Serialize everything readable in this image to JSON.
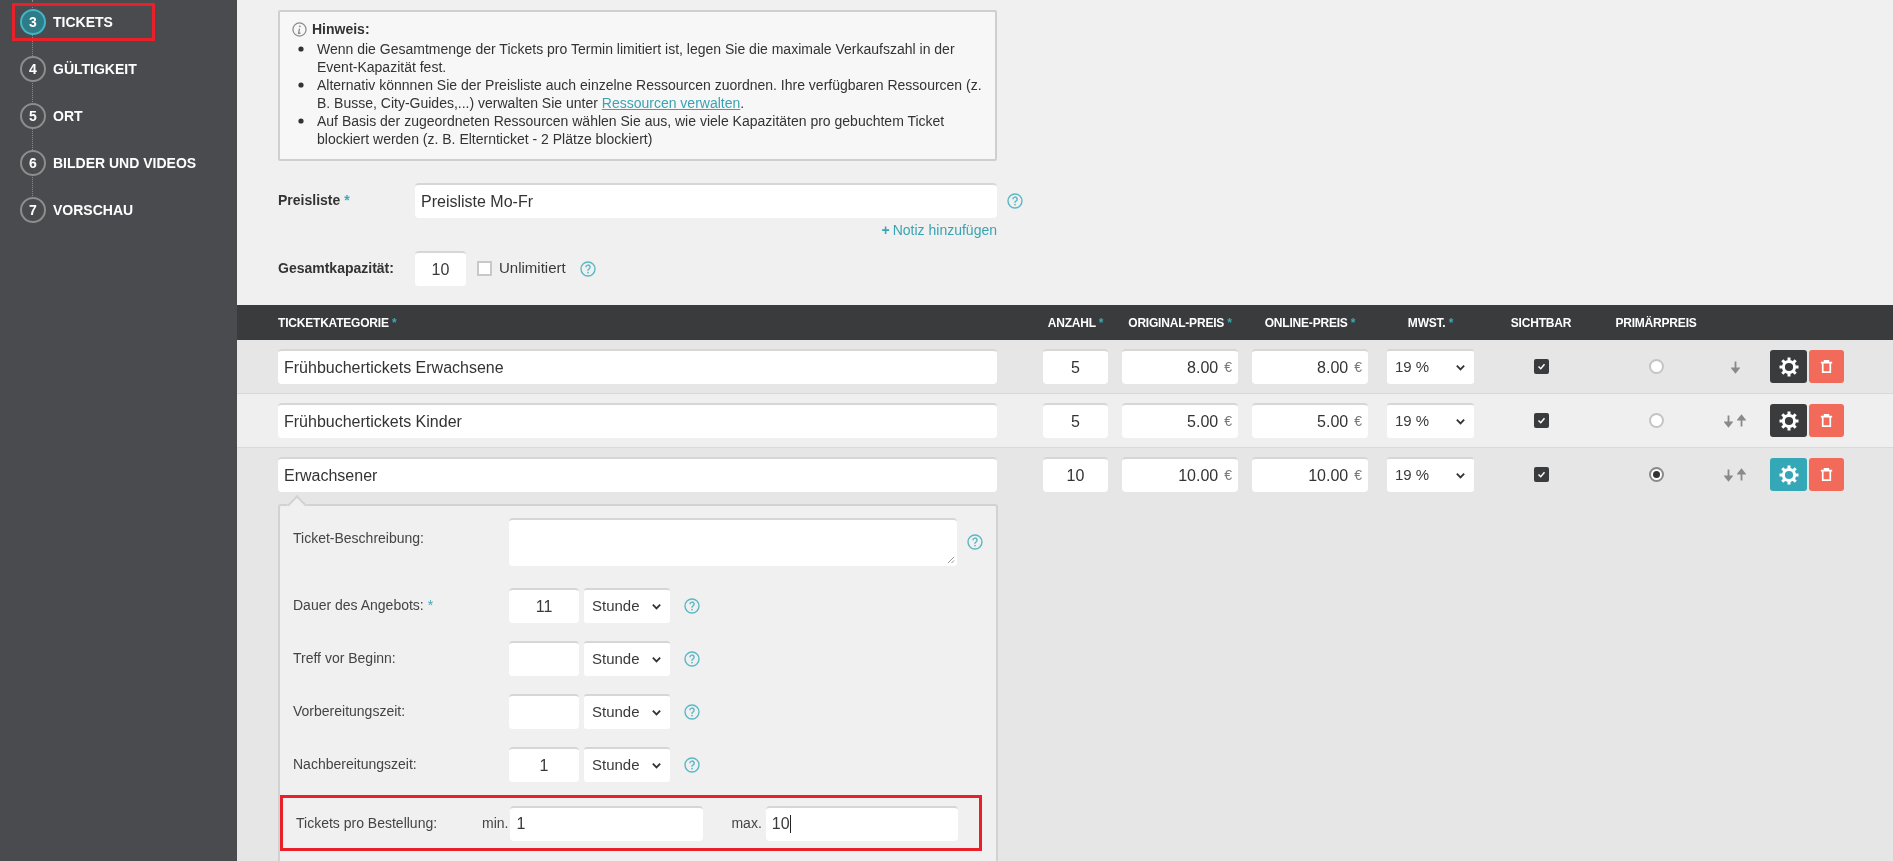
{
  "sidebar": {
    "steps": [
      {
        "number": "3",
        "label": "TICKETS",
        "selected": true,
        "highlighted": true
      },
      {
        "number": "4",
        "label": "GÜLTIGKEIT",
        "selected": false,
        "highlighted": false
      },
      {
        "number": "5",
        "label": "ORT",
        "selected": false,
        "highlighted": false
      },
      {
        "number": "6",
        "label": "BILDER UND VIDEOS",
        "selected": false,
        "highlighted": false
      },
      {
        "number": "7",
        "label": "VORSCHAU",
        "selected": false,
        "highlighted": false
      }
    ]
  },
  "hint": {
    "title": "Hinweis:",
    "items": [
      {
        "text": "Wenn die Gesamtmenge der Tickets pro Termin limitiert ist, legen Sie die maximale Verkaufszahl in der Event-Kapazität fest."
      },
      {
        "text": "Alternativ könnnen Sie der Preisliste auch einzelne Ressourcen zuordnen. Ihre verfügbaren Ressourcen (z. B. Busse, City-Guides,...) verwalten Sie unter ",
        "link": "Ressourcen verwalten",
        "tail": "."
      },
      {
        "text": "Auf Basis der zugeordneten Ressourcen wählen Sie aus, wie viele Kapazitäten pro gebuchtem Ticket blockiert werden (z. B. Elternticket - 2 Plätze blockiert)"
      }
    ]
  },
  "price_list": {
    "label": "Preisliste",
    "mark": "*",
    "value": "Preisliste Mo-Fr",
    "note_plus": "+",
    "note_link": "Notiz hinzufügen"
  },
  "capacity": {
    "label": "Gesamtkapazität:",
    "value": "10",
    "unlimited_label": "Unlimitiert",
    "unlimited": false
  },
  "table": {
    "columns": [
      {
        "label": "TICKETKATEGORIE",
        "mark": "*"
      },
      {
        "label": "ANZAHL",
        "mark": "*"
      },
      {
        "label": "ORIGINAL-PREIS",
        "mark": "*"
      },
      {
        "label": "ONLINE-PREIS",
        "mark": "*"
      },
      {
        "label": "MWST.",
        "mark": "*"
      },
      {
        "label": "SICHTBAR"
      },
      {
        "label": "PRIMÄRPREIS"
      }
    ],
    "rows": [
      {
        "name": "Frühbuchertickets Erwachsene",
        "count": "5",
        "original_price": "8.00",
        "original_currency": "€",
        "online_price": "8.00",
        "online_currency": "€",
        "vat": "19 %",
        "visible": true,
        "selected": false,
        "move_down": true,
        "move_up": false,
        "expanded": false
      },
      {
        "name": "Frühbuchertickets Kinder",
        "count": "5",
        "original_price": "5.00",
        "original_currency": "€",
        "online_price": "5.00",
        "online_currency": "€",
        "vat": "19 %",
        "visible": true,
        "selected": false,
        "move_down": true,
        "move_up": true,
        "expanded": false
      },
      {
        "name": "Erwachsener",
        "count": "10",
        "original_price": "10.00",
        "original_currency": "€",
        "online_price": "10.00",
        "online_currency": "€",
        "vat": "19 %",
        "visible": true,
        "selected": true,
        "move_down": true,
        "move_up": true,
        "expanded": true
      }
    ]
  },
  "details": {
    "fields": [
      {
        "kind": "textarea",
        "label": "Ticket-Beschreibung:"
      },
      {
        "kind": "duration",
        "label": "Dauer des Angebots:",
        "mark": "*",
        "value": "11",
        "unit": "Stunde"
      },
      {
        "kind": "duration",
        "label": "Treff vor Beginn:",
        "unit": "Stunde"
      },
      {
        "kind": "duration",
        "label": "Vorbereitungszeit:",
        "unit": "Stunde"
      },
      {
        "kind": "duration",
        "label": "Nachbereitungszeit:",
        "value": "1",
        "unit": "Stunde"
      }
    ],
    "order_limit": {
      "label": "Tickets pro Bestellung:",
      "min_label": "min.",
      "min_value": "1",
      "max_label": "max.",
      "max_value": "10",
      "focused": true,
      "highlighted": true
    }
  }
}
